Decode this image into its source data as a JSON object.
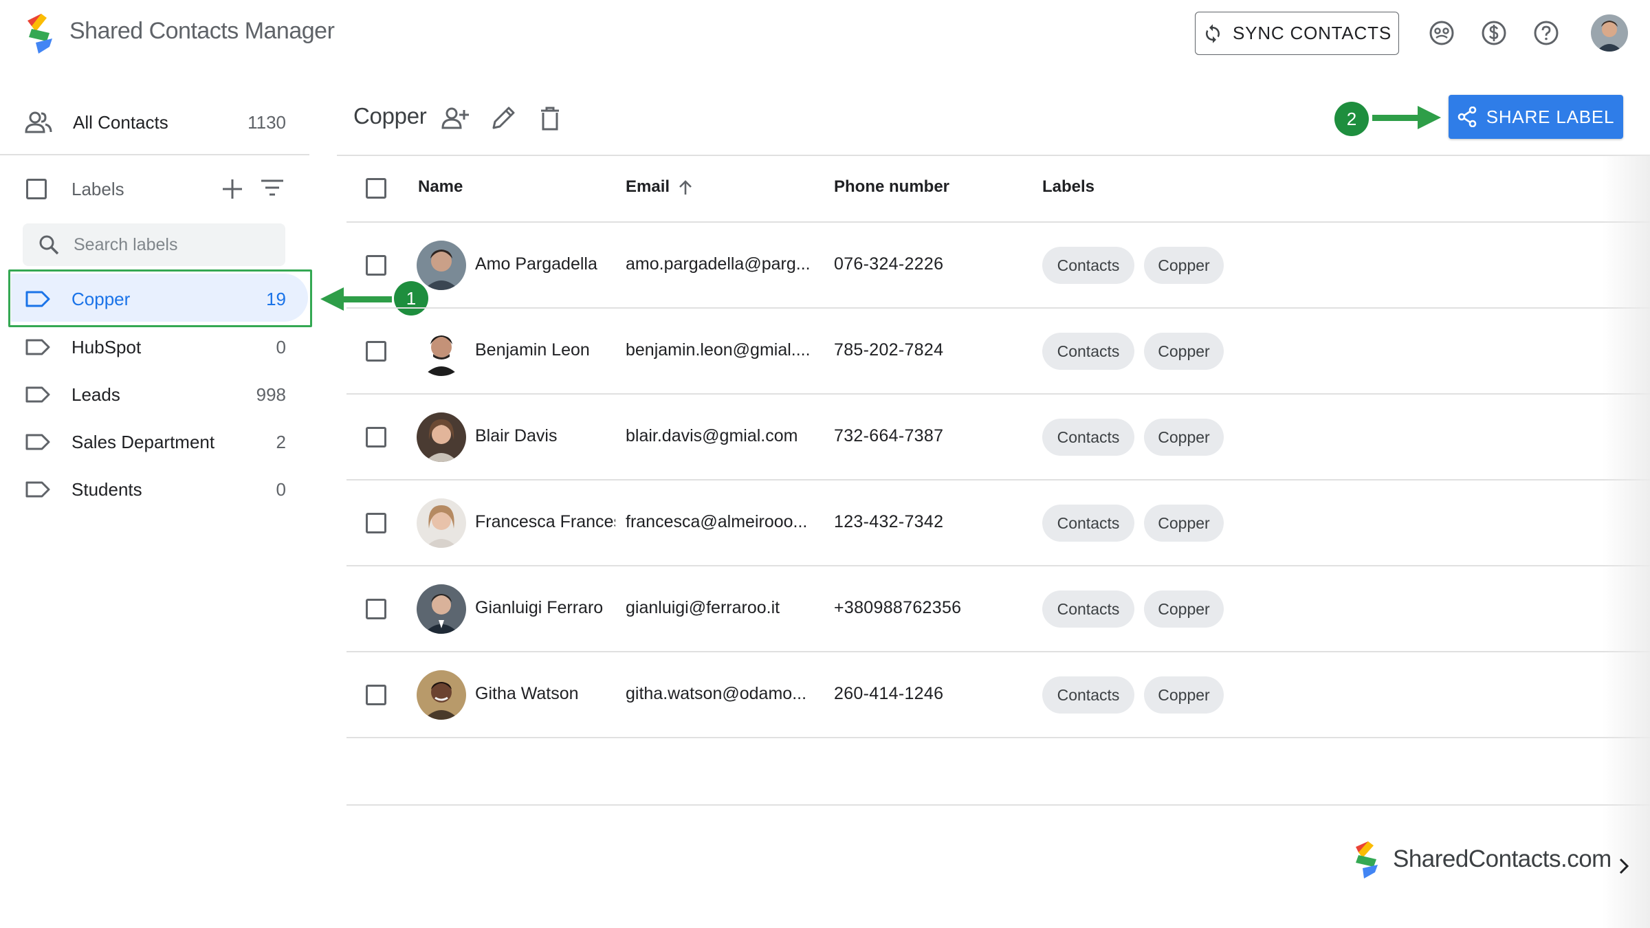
{
  "app": {
    "title": "Shared Contacts Manager",
    "sync_label": "SYNC CONTACTS"
  },
  "header_icons": [
    "support-icon",
    "billing-icon",
    "help-icon",
    "user-avatar"
  ],
  "sidebar": {
    "all_contacts": {
      "label": "All Contacts",
      "count": "1130"
    },
    "labels_header": "Labels",
    "search_placeholder": "Search labels",
    "items": [
      {
        "name": "Copper",
        "count": "19",
        "active": true
      },
      {
        "name": "HubSpot",
        "count": "0"
      },
      {
        "name": "Leads",
        "count": "998"
      },
      {
        "name": "Sales Department",
        "count": "2"
      },
      {
        "name": "Students",
        "count": "0"
      }
    ]
  },
  "main": {
    "title": "Copper",
    "share_label": "SHARE LABEL",
    "columns": {
      "name": "Name",
      "email": "Email",
      "phone": "Phone number",
      "labels": "Labels"
    },
    "rows": [
      {
        "name": "Amo Pargadella",
        "email": "amo.pargadella@parg...",
        "phone": "076-324-2226",
        "labels": [
          "Contacts",
          "Copper"
        ]
      },
      {
        "name": "Benjamin Leon",
        "email": "benjamin.leon@gmial....",
        "phone": "785-202-7824",
        "labels": [
          "Contacts",
          "Copper"
        ]
      },
      {
        "name": "Blair Davis",
        "email": "blair.davis@gmial.com",
        "phone": "732-664-7387",
        "labels": [
          "Contacts",
          "Copper"
        ]
      },
      {
        "name": "Francesca Francesco",
        "email": "francesca@almeirooo...",
        "phone": "123-432-7342",
        "labels": [
          "Contacts",
          "Copper"
        ]
      },
      {
        "name": "Gianluigi Ferraro",
        "email": "gianluigi@ferraroo.it",
        "phone": "+380988762356",
        "labels": [
          "Contacts",
          "Copper"
        ]
      },
      {
        "name": "Githa Watson",
        "email": "githa.watson@odamo...",
        "phone": "260-414-1246",
        "labels": [
          "Contacts",
          "Copper"
        ]
      }
    ]
  },
  "annotations": {
    "step1": "1",
    "step2": "2"
  },
  "footer": {
    "brand": "SharedContacts.com"
  },
  "colors": {
    "accent": "#2f7de8",
    "active_label": "#1a73e8",
    "active_bg": "#e8f0fe",
    "annotation_green": "#1e8e3e"
  }
}
